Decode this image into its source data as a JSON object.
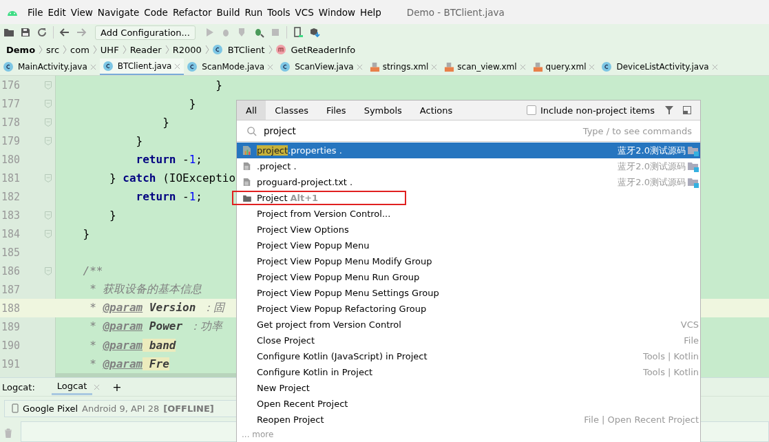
{
  "window": {
    "title": "Demo - BTClient.java"
  },
  "menu": [
    "File",
    "Edit",
    "View",
    "Navigate",
    "Code",
    "Refactor",
    "Build",
    "Run",
    "Tools",
    "VCS",
    "Window",
    "Help"
  ],
  "toolbar": {
    "run_config": "Add Configuration..."
  },
  "breadcrumbs": [
    {
      "label": "Demo",
      "kind": "project"
    },
    {
      "label": "src",
      "kind": "folder"
    },
    {
      "label": "com",
      "kind": "folder"
    },
    {
      "label": "UHF",
      "kind": "folder"
    },
    {
      "label": "Reader",
      "kind": "folder"
    },
    {
      "label": "R2000",
      "kind": "folder"
    },
    {
      "label": "BTClient",
      "kind": "class"
    },
    {
      "label": "GetReaderInfo",
      "kind": "method"
    }
  ],
  "tabs": [
    {
      "label": "MainActivity.java",
      "kind": "class",
      "selected": false
    },
    {
      "label": "BTClient.java",
      "kind": "class",
      "selected": true
    },
    {
      "label": "ScanMode.java",
      "kind": "class",
      "selected": false
    },
    {
      "label": "ScanView.java",
      "kind": "class",
      "selected": false
    },
    {
      "label": "strings.xml",
      "kind": "xml",
      "selected": false
    },
    {
      "label": "scan_view.xml",
      "kind": "xml",
      "selected": false
    },
    {
      "label": "query.xml",
      "kind": "xml",
      "selected": false
    },
    {
      "label": "DeviceListActivity.java",
      "kind": "class",
      "selected": false
    }
  ],
  "editor": {
    "lines": [
      {
        "number": "176",
        "fold": true,
        "current": false,
        "tokens": [
          {
            "kind": "plain",
            "text": "                        }"
          }
        ]
      },
      {
        "number": "177",
        "fold": true,
        "current": false,
        "tokens": [
          {
            "kind": "plain",
            "text": "                    }"
          }
        ]
      },
      {
        "number": "178",
        "fold": true,
        "current": false,
        "tokens": [
          {
            "kind": "plain",
            "text": "                }"
          }
        ]
      },
      {
        "number": "179",
        "fold": true,
        "current": false,
        "tokens": [
          {
            "kind": "plain",
            "text": "            }"
          }
        ]
      },
      {
        "number": "180",
        "fold": false,
        "current": false,
        "tokens": [
          {
            "kind": "keyword",
            "text": "            return"
          },
          {
            "kind": "plain",
            "text": " -"
          },
          {
            "kind": "number",
            "text": "1"
          },
          {
            "kind": "plain",
            "text": ";"
          }
        ]
      },
      {
        "number": "181",
        "fold": true,
        "current": false,
        "tokens": [
          {
            "kind": "plain",
            "text": "        } "
          },
          {
            "kind": "keyword",
            "text": "catch"
          },
          {
            "kind": "plain",
            "text": " (IOExceptio"
          }
        ]
      },
      {
        "number": "182",
        "fold": false,
        "current": false,
        "tokens": [
          {
            "kind": "keyword",
            "text": "            return"
          },
          {
            "kind": "plain",
            "text": " -"
          },
          {
            "kind": "number",
            "text": "1"
          },
          {
            "kind": "plain",
            "text": ";"
          }
        ]
      },
      {
        "number": "183",
        "fold": true,
        "current": false,
        "tokens": [
          {
            "kind": "plain",
            "text": "        }"
          }
        ]
      },
      {
        "number": "184",
        "fold": true,
        "current": false,
        "tokens": [
          {
            "kind": "plain",
            "text": "    }"
          }
        ]
      },
      {
        "number": "185",
        "fold": false,
        "current": false
      },
      {
        "number": "186",
        "fold": true,
        "current": false,
        "tokens": [
          {
            "kind": "comment",
            "text": "    /**"
          }
        ]
      },
      {
        "number": "187",
        "fold": false,
        "current": false,
        "tokens": [
          {
            "kind": "comment",
            "text": "     * 获取设备的基本信息"
          }
        ]
      },
      {
        "number": "188",
        "fold": false,
        "current": true,
        "tokens": [
          {
            "kind": "comment",
            "text": "     * "
          },
          {
            "kind": "tag",
            "text": "@param"
          },
          {
            "kind": "param",
            "text": " Version"
          },
          {
            "kind": "comment",
            "text": " ：固"
          }
        ]
      },
      {
        "number": "189",
        "fold": false,
        "current": false,
        "tokens": [
          {
            "kind": "comment",
            "text": "     * "
          },
          {
            "kind": "tag",
            "text": "@param"
          },
          {
            "kind": "param",
            "text": " Power"
          },
          {
            "kind": "comment",
            "text": " ：功率"
          }
        ]
      },
      {
        "number": "190",
        "fold": false,
        "current": false,
        "tokens": [
          {
            "kind": "comment",
            "text": "     * "
          },
          {
            "kind": "tag",
            "text": "@param"
          },
          {
            "kind": "param-marked",
            "text": " band"
          }
        ]
      },
      {
        "number": "191",
        "fold": false,
        "current": false,
        "tokens": [
          {
            "kind": "comment",
            "text": "     * "
          },
          {
            "kind": "tag",
            "text": "@param"
          },
          {
            "kind": "param-marked",
            "text": " Fre"
          }
        ]
      }
    ]
  },
  "logcat": {
    "label": "Logcat:",
    "tabs": [
      {
        "label": "Logcat",
        "selected": true
      }
    ],
    "add": "+",
    "device": {
      "name": "Google Pixel",
      "detail": "Android 9, API 28",
      "status": "[OFFLINE]"
    }
  },
  "search_popup": {
    "tabs": [
      {
        "label": "All",
        "selected": true
      },
      {
        "label": "Classes",
        "selected": false
      },
      {
        "label": "Files",
        "selected": false
      },
      {
        "label": "Symbols",
        "selected": false
      },
      {
        "label": "Actions",
        "selected": false
      }
    ],
    "include_non_project": {
      "label": "Include non-project items",
      "checked": false
    },
    "query": "project",
    "hint": "Type / to see commands",
    "results": [
      {
        "kind": "properties-file",
        "match": "project",
        "name": ".properties .",
        "location": "蓝牙2.0测试源码",
        "selected": true,
        "boxed": false
      },
      {
        "kind": "text-file",
        "name": ".project .",
        "location": "蓝牙2.0测试源码",
        "selected": false,
        "boxed": false
      },
      {
        "kind": "text-file",
        "name": "proguard-project.txt .",
        "location": "蓝牙2.0测试源码",
        "selected": false,
        "boxed": false
      },
      {
        "kind": "folder-action",
        "name": "Project",
        "shortcut": "Alt+1",
        "selected": false,
        "boxed": true
      },
      {
        "kind": "action",
        "name": "Project from Version Control...",
        "selected": false,
        "boxed": false
      },
      {
        "kind": "action",
        "name": "Project View Options",
        "selected": false,
        "boxed": false
      },
      {
        "kind": "action",
        "name": "Project View Popup Menu",
        "selected": false,
        "boxed": false
      },
      {
        "kind": "action",
        "name": "Project View Popup Menu Modify Group",
        "selected": false,
        "boxed": false
      },
      {
        "kind": "action",
        "name": "Project View Popup Menu Run Group",
        "selected": false,
        "boxed": false
      },
      {
        "kind": "action",
        "name": "Project View Popup Menu Settings Group",
        "selected": false,
        "boxed": false
      },
      {
        "kind": "action",
        "name": "Project View Popup Refactoring Group",
        "selected": false,
        "boxed": false
      },
      {
        "kind": "action",
        "name": "Get project from Version Control",
        "group": "VCS",
        "selected": false,
        "boxed": false
      },
      {
        "kind": "action",
        "name": "Close Project",
        "group": "File",
        "selected": false,
        "boxed": false
      },
      {
        "kind": "action",
        "name": "Configure Kotlin (JavaScript) in Project",
        "group": "Tools | Kotlin",
        "selected": false,
        "boxed": false
      },
      {
        "kind": "action",
        "name": "Configure Kotlin in Project",
        "group": "Tools | Kotlin",
        "selected": false,
        "boxed": false
      },
      {
        "kind": "action",
        "name": "New Project",
        "selected": false,
        "boxed": false
      },
      {
        "kind": "action",
        "name": "Open Recent Project",
        "selected": false,
        "boxed": false
      },
      {
        "kind": "action",
        "name": "Reopen Project",
        "group": "File | Open Recent Project",
        "selected": false,
        "boxed": false
      }
    ],
    "more": "... more"
  }
}
